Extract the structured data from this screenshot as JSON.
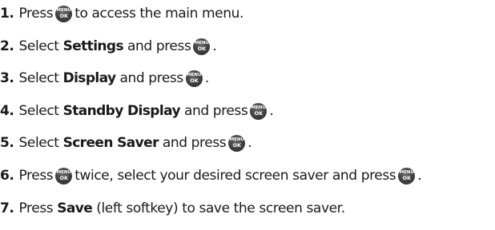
{
  "key": {
    "line1": "MENU",
    "line2": "OK"
  },
  "steps": [
    {
      "num": "1.",
      "a": "Press",
      "b": "to access the main menu."
    },
    {
      "num": "2.",
      "a": "Select",
      "bold": "Settings",
      "b": "and press",
      "end": "."
    },
    {
      "num": "3.",
      "a": "Select",
      "bold": "Display",
      "b": "and press",
      "end": "."
    },
    {
      "num": "4.",
      "a": "Select",
      "bold": "Standby Display",
      "b": "and press",
      "end": "."
    },
    {
      "num": "5.",
      "a": "Select",
      "bold": "Screen Saver",
      "b": "and press",
      "end": "."
    },
    {
      "num": "6.",
      "a": "Press",
      "b": "twice, select your desired screen saver and press",
      "end": "."
    },
    {
      "num": "7.",
      "a": "Press",
      "bold": "Save",
      "b": "(left softkey) to save the screen saver."
    }
  ]
}
